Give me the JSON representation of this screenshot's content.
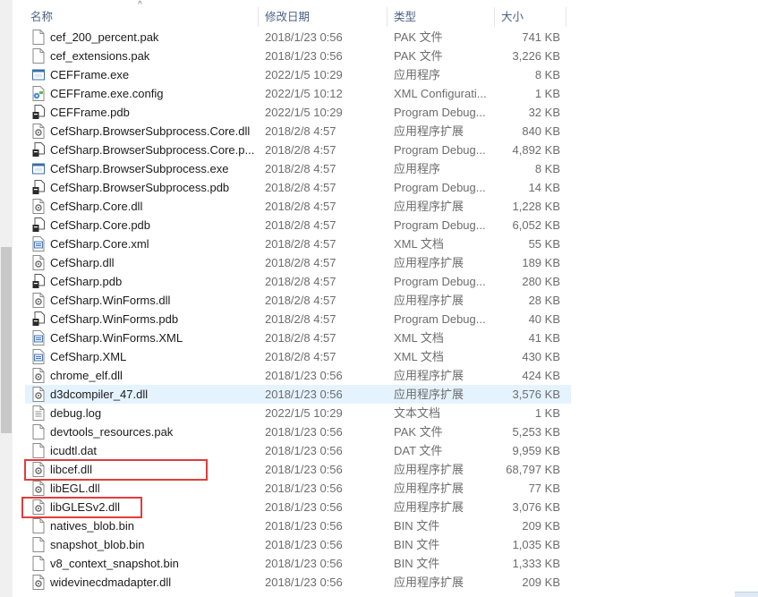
{
  "header": {
    "name": "名称",
    "date": "修改日期",
    "type": "类型",
    "size": "大小",
    "sort_arrow": "^"
  },
  "files": [
    {
      "name": "cef_200_percent.pak",
      "date": "2018/1/23 0:56",
      "type": "PAK 文件",
      "size": "741 KB",
      "icon": "file-icon"
    },
    {
      "name": "cef_extensions.pak",
      "date": "2018/1/23 0:56",
      "type": "PAK 文件",
      "size": "3,226 KB",
      "icon": "file-icon"
    },
    {
      "name": "CEFFrame.exe",
      "date": "2022/1/5 10:29",
      "type": "应用程序",
      "size": "8 KB",
      "icon": "exe-icon"
    },
    {
      "name": "CEFFrame.exe.config",
      "date": "2022/1/5 10:12",
      "type": "XML Configurati...",
      "size": "1 KB",
      "icon": "config-icon"
    },
    {
      "name": "CEFFrame.pdb",
      "date": "2022/1/5 10:29",
      "type": "Program Debug...",
      "size": "32 KB",
      "icon": "pdb-icon"
    },
    {
      "name": "CefSharp.BrowserSubprocess.Core.dll",
      "date": "2018/2/8 4:57",
      "type": "应用程序扩展",
      "size": "840 KB",
      "icon": "dll-icon"
    },
    {
      "name": "CefSharp.BrowserSubprocess.Core.p...",
      "date": "2018/2/8 4:57",
      "type": "Program Debug...",
      "size": "4,892 KB",
      "icon": "pdb-icon"
    },
    {
      "name": "CefSharp.BrowserSubprocess.exe",
      "date": "2018/2/8 4:57",
      "type": "应用程序",
      "size": "8 KB",
      "icon": "exe-icon"
    },
    {
      "name": "CefSharp.BrowserSubprocess.pdb",
      "date": "2018/2/8 4:57",
      "type": "Program Debug...",
      "size": "14 KB",
      "icon": "pdb-icon"
    },
    {
      "name": "CefSharp.Core.dll",
      "date": "2018/2/8 4:57",
      "type": "应用程序扩展",
      "size": "1,228 KB",
      "icon": "dll-icon"
    },
    {
      "name": "CefSharp.Core.pdb",
      "date": "2018/2/8 4:57",
      "type": "Program Debug...",
      "size": "6,052 KB",
      "icon": "pdb-icon"
    },
    {
      "name": "CefSharp.Core.xml",
      "date": "2018/2/8 4:57",
      "type": "XML 文档",
      "size": "55 KB",
      "icon": "xml-icon"
    },
    {
      "name": "CefSharp.dll",
      "date": "2018/2/8 4:57",
      "type": "应用程序扩展",
      "size": "189 KB",
      "icon": "dll-icon"
    },
    {
      "name": "CefSharp.pdb",
      "date": "2018/2/8 4:57",
      "type": "Program Debug...",
      "size": "280 KB",
      "icon": "pdb-icon"
    },
    {
      "name": "CefSharp.WinForms.dll",
      "date": "2018/2/8 4:57",
      "type": "应用程序扩展",
      "size": "28 KB",
      "icon": "dll-icon"
    },
    {
      "name": "CefSharp.WinForms.pdb",
      "date": "2018/2/8 4:57",
      "type": "Program Debug...",
      "size": "40 KB",
      "icon": "pdb-icon"
    },
    {
      "name": "CefSharp.WinForms.XML",
      "date": "2018/2/8 4:57",
      "type": "XML 文档",
      "size": "41 KB",
      "icon": "xml-icon"
    },
    {
      "name": "CefSharp.XML",
      "date": "2018/2/8 4:57",
      "type": "XML 文档",
      "size": "430 KB",
      "icon": "xml-icon"
    },
    {
      "name": "chrome_elf.dll",
      "date": "2018/1/23 0:56",
      "type": "应用程序扩展",
      "size": "424 KB",
      "icon": "dll-icon"
    },
    {
      "name": "d3dcompiler_47.dll",
      "date": "2018/1/23 0:56",
      "type": "应用程序扩展",
      "size": "3,576 KB",
      "icon": "dll-icon"
    },
    {
      "name": "debug.log",
      "date": "2022/1/5 10:29",
      "type": "文本文档",
      "size": "1 KB",
      "icon": "text-file-icon"
    },
    {
      "name": "devtools_resources.pak",
      "date": "2018/1/23 0:56",
      "type": "PAK 文件",
      "size": "5,253 KB",
      "icon": "file-icon"
    },
    {
      "name": "icudtl.dat",
      "date": "2018/1/23 0:56",
      "type": "DAT 文件",
      "size": "9,959 KB",
      "icon": "file-icon"
    },
    {
      "name": "libcef.dll",
      "date": "2018/1/23 0:56",
      "type": "应用程序扩展",
      "size": "68,797 KB",
      "icon": "dll-icon"
    },
    {
      "name": "libEGL.dll",
      "date": "2018/1/23 0:56",
      "type": "应用程序扩展",
      "size": "77 KB",
      "icon": "dll-icon"
    },
    {
      "name": "libGLESv2.dll",
      "date": "2018/1/23 0:56",
      "type": "应用程序扩展",
      "size": "3,076 KB",
      "icon": "dll-icon"
    },
    {
      "name": "natives_blob.bin",
      "date": "2018/1/23 0:56",
      "type": "BIN 文件",
      "size": "209 KB",
      "icon": "file-icon"
    },
    {
      "name": "snapshot_blob.bin",
      "date": "2018/1/23 0:56",
      "type": "BIN 文件",
      "size": "1,035 KB",
      "icon": "file-icon"
    },
    {
      "name": "v8_context_snapshot.bin",
      "date": "2018/1/23 0:56",
      "type": "BIN 文件",
      "size": "1,333 KB",
      "icon": "file-icon"
    },
    {
      "name": "widevinecdmadapter.dll",
      "date": "2018/1/23 0:56",
      "type": "应用程序扩展",
      "size": "209 KB",
      "icon": "dll-icon"
    }
  ],
  "hover_row_index": 19,
  "highlight_color": "#e23c3c",
  "highlighted_files": [
    "libcef.dll",
    "libGLESv2.dll"
  ]
}
